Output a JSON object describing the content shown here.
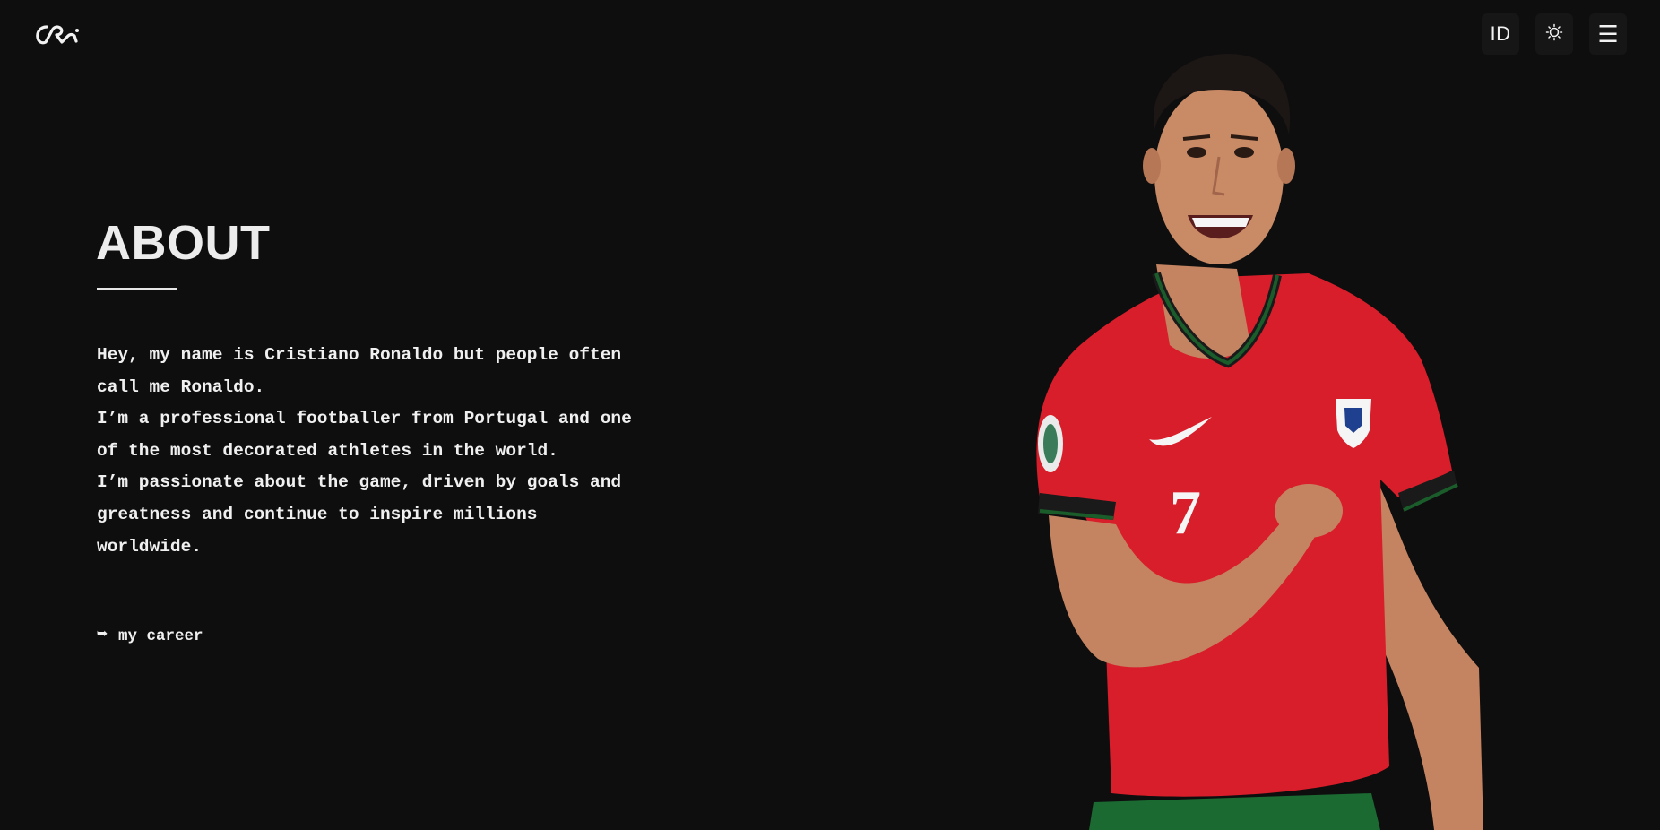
{
  "header": {
    "logo_alt": "CR",
    "lang_label": "ID",
    "theme_icon": "sun-icon",
    "menu_icon": "hamburger-menu-icon",
    "menu_glyph": "☰"
  },
  "about": {
    "title": "ABOUT",
    "paragraphs": [
      "Hey, my name is Cristiano Ronaldo but people often call me Ronaldo.",
      "I’m a professional footballer from Portugal and one of the most decorated athletes in the world.",
      "I’m passionate about the game, driven by goals and greatness and continue to inspire millions worldwide."
    ],
    "cta_arrow": "➥",
    "cta_label": "my career"
  },
  "player_image": {
    "shirt_number": "7",
    "colors": {
      "shirt": "#d81e2a",
      "collar": "#1a5d2a",
      "skin": "#c98a66",
      "hair": "#1c1614",
      "shorts": "#1b6a32"
    }
  },
  "colors": {
    "background": "#0e0e0f",
    "text": "#f0f0f0",
    "button_bg": "#161617"
  }
}
